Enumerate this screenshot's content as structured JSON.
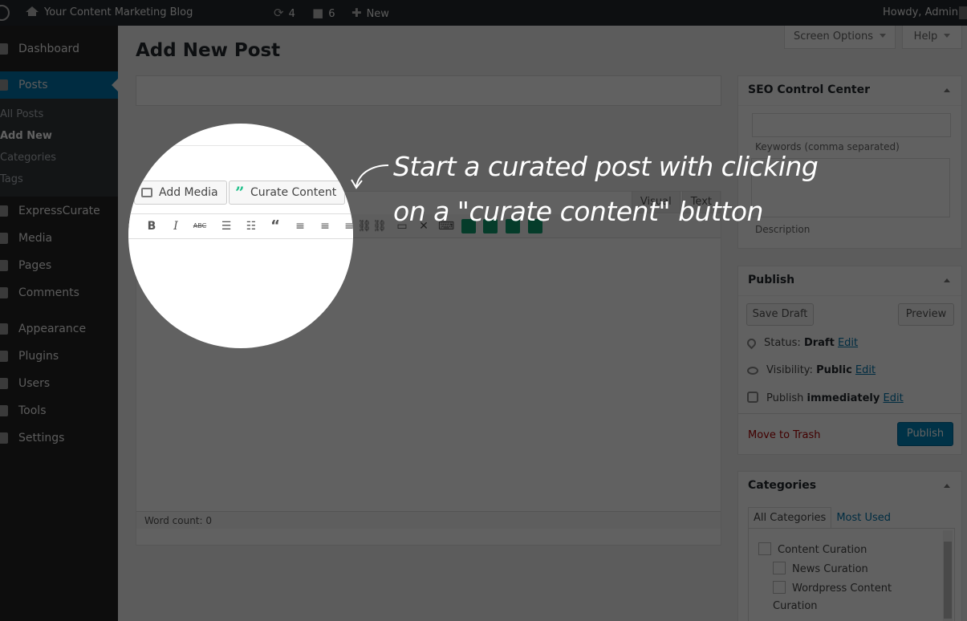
{
  "admin_bar": {
    "site_name": "Your Content Marketing Blog",
    "updates_count": "4",
    "comments_count": "6",
    "new_label": "New",
    "greeting": "Howdy, Admin"
  },
  "sidebar": {
    "items": [
      {
        "label": "Dashboard",
        "icon": "dashboard-icon"
      },
      {
        "label": "Posts",
        "icon": "pin-icon"
      },
      {
        "label": "ExpressCurate",
        "icon": "quote-icon"
      },
      {
        "label": "Media",
        "icon": "media-icon"
      },
      {
        "label": "Pages",
        "icon": "pages-icon"
      },
      {
        "label": "Comments",
        "icon": "comments-icon"
      },
      {
        "label": "Appearance",
        "icon": "appearance-icon"
      },
      {
        "label": "Plugins",
        "icon": "plugins-icon"
      },
      {
        "label": "Users",
        "icon": "users-icon"
      },
      {
        "label": "Tools",
        "icon": "tools-icon"
      },
      {
        "label": "Settings",
        "icon": "settings-icon"
      }
    ],
    "submenu": [
      "All Posts",
      "Add New",
      "Categories",
      "Tags"
    ]
  },
  "screen_options": "Screen Options",
  "help": "Help",
  "page_title": "Add New Post",
  "editor": {
    "add_media": "Add Media",
    "curate_content": "Curate Content",
    "tab_visual": "Visual",
    "tab_text": "Text",
    "word_count": "Word count: 0"
  },
  "callout": {
    "line1": "Start a curated post with clicking",
    "line2": "on a \"curate content\" button"
  },
  "seo_box": {
    "title": "SEO Control Center",
    "keywords_label": "Keywords (comma separated)",
    "description_label": "Description"
  },
  "publish_box": {
    "title": "Publish",
    "save_draft": "Save Draft",
    "preview": "Preview",
    "status_label": "Status:",
    "status_value": "Draft",
    "visibility_label": "Visibility:",
    "visibility_value": "Public",
    "publish_label": "Publish",
    "publish_value": "immediately",
    "edit": "Edit",
    "move_to_trash": "Move to Trash",
    "publish_button": "Publish"
  },
  "categories_box": {
    "title": "Categories",
    "tab_all": "All Categories",
    "tab_most_used": "Most Used",
    "items": [
      "Content Curation",
      "News Curation",
      "Wordpress Content",
      "Curation"
    ]
  },
  "colors": {
    "accent": "#0073aa",
    "admin_bar": "#23282d",
    "curate_quote": "#21c08b"
  }
}
